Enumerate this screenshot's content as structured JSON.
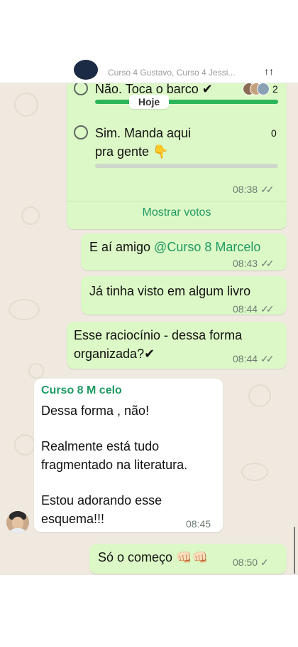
{
  "header": {
    "members": "Curso 4 Gustavo, Curso 4 Jessi...",
    "menu_glyph": "↑↑"
  },
  "date_chip": "Hoje",
  "poll": {
    "options": [
      {
        "label": "Não. Toca o barco ✔",
        "votes": "2",
        "fraction": 1.0
      },
      {
        "label_line1": "Sim. Manda  aqui",
        "label_line2": "pra gente 👇",
        "votes": "0",
        "fraction": 0.0
      }
    ],
    "time": "08:38",
    "show_votes": "Mostrar votos",
    "colors": {
      "bar_fill": "#2cb45a",
      "bar_empty": "#cfd8cc"
    }
  },
  "messages": [
    {
      "prefix": "E aí amigo ",
      "mention": "@Curso 8 Marcelo",
      "time": "08:43"
    },
    {
      "text": "Já tinha visto em algum livro",
      "time": "08:44"
    },
    {
      "line1": "Esse raciocínio - dessa forma",
      "line2": "organizada?✔",
      "time": "08:44"
    }
  ],
  "incoming": {
    "sender": "Curso 8 M   celo",
    "lines": [
      "Dessa forma , não!",
      "",
      "Realmente está tudo",
      "fragmentado na literatura.",
      "",
      "Estou adorando esse",
      "esquema!!!"
    ],
    "time": "08:45"
  },
  "last_message": {
    "text": "Só o começo 👊🏻👊🏻",
    "time": "08:50",
    "tick": "✓"
  },
  "double_tick": "✓✓"
}
